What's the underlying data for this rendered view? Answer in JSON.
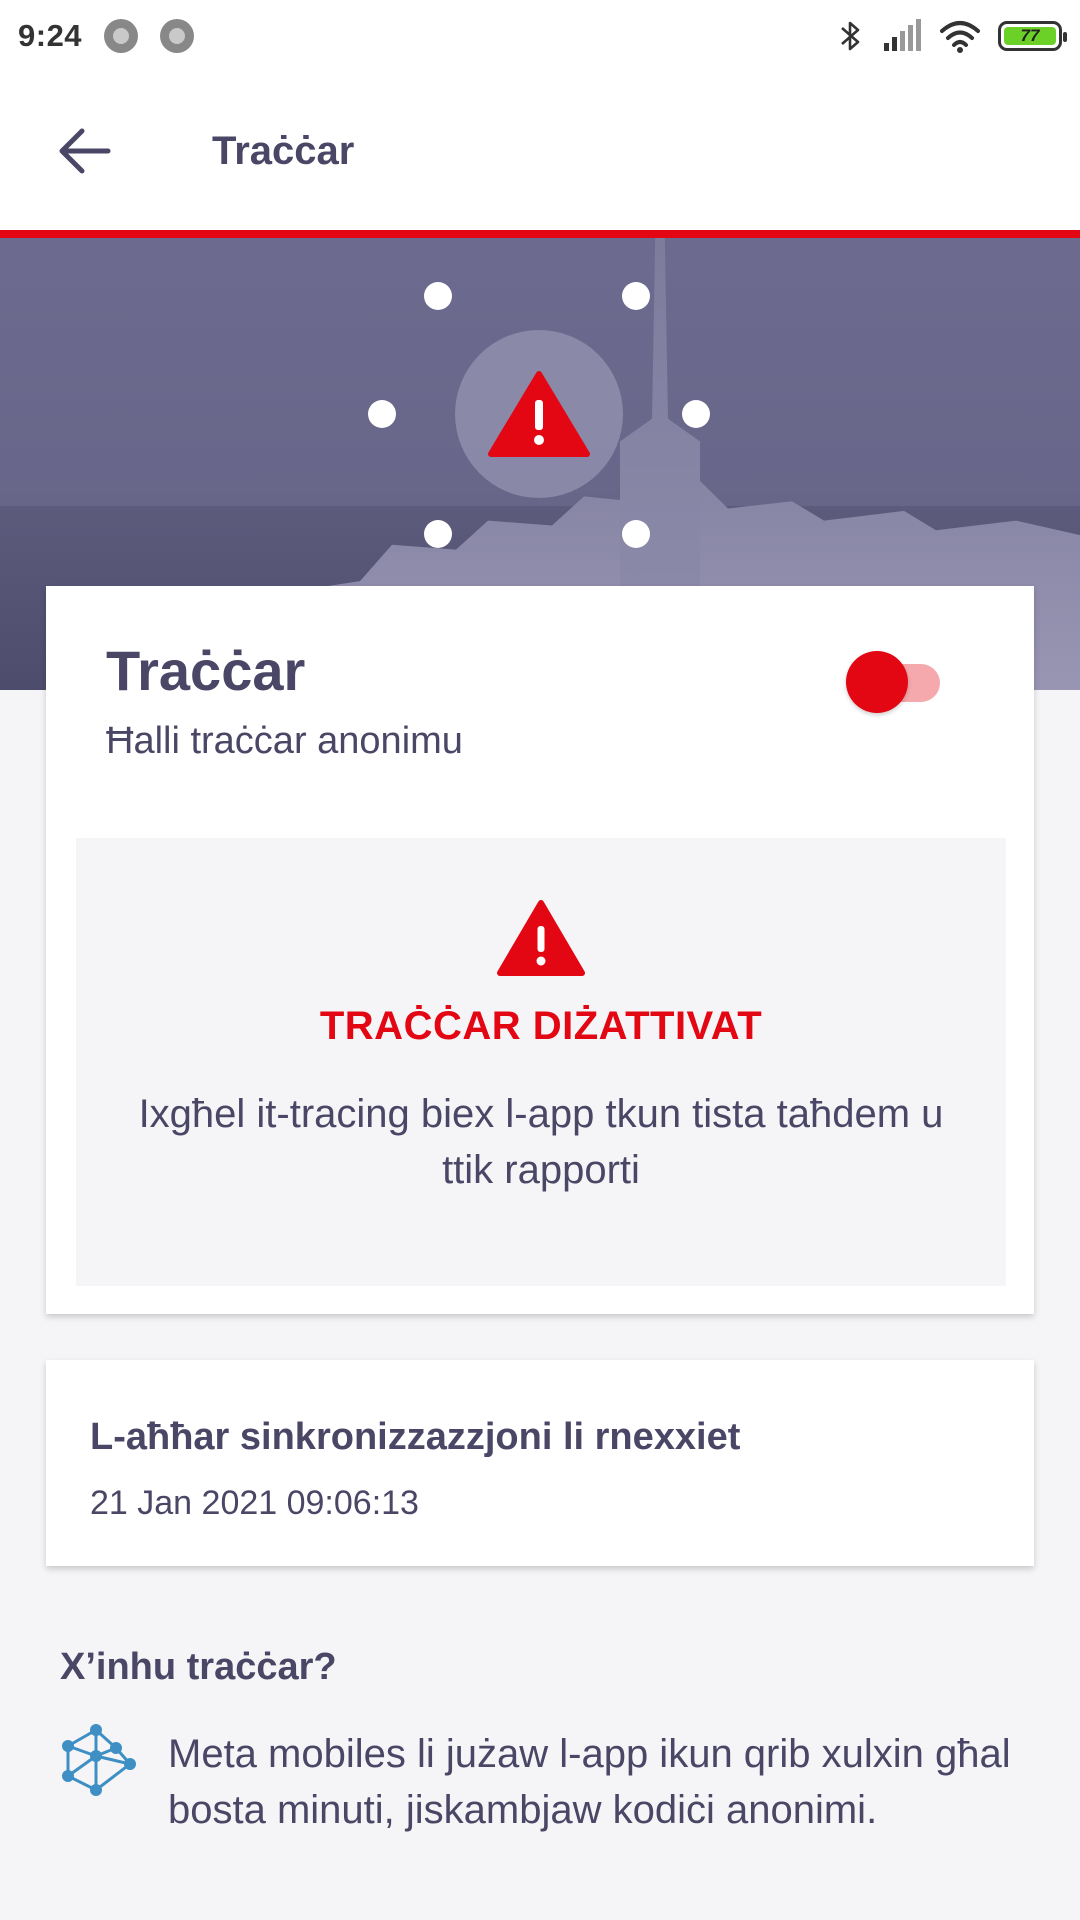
{
  "status_bar": {
    "time": "9:24",
    "battery_level": "77",
    "battery_color": "#6bd126"
  },
  "app_bar": {
    "back_icon": "arrow-left-icon",
    "title": "Traċċar"
  },
  "colors": {
    "accent": "#e30613",
    "text": "#4a4766",
    "background": "#f5f5f7"
  },
  "tracing_card": {
    "title": "Traċċar",
    "subtitle": "Ħalli traċċar anonimu",
    "toggle_on": false,
    "status_icon": "warning-icon",
    "status_label": "TRAĊĊAR DIŻATTIVAT",
    "status_description": "Ixgħel it-tracing biex l-app tkun tista taħdem u ttik rapporti"
  },
  "sync_card": {
    "title": "L-aħħar sinkronizzazzjoni li rnexxiet",
    "date": "21 Jan 2021 09:06:13"
  },
  "info_section": {
    "title": "X’inhu traċċar?",
    "icon": "network-nodes-icon",
    "text": "Meta mobiles li jużaw l-app ikun qrib xulxin għal bosta minuti, jiskambjaw kodiċi anonimi."
  }
}
